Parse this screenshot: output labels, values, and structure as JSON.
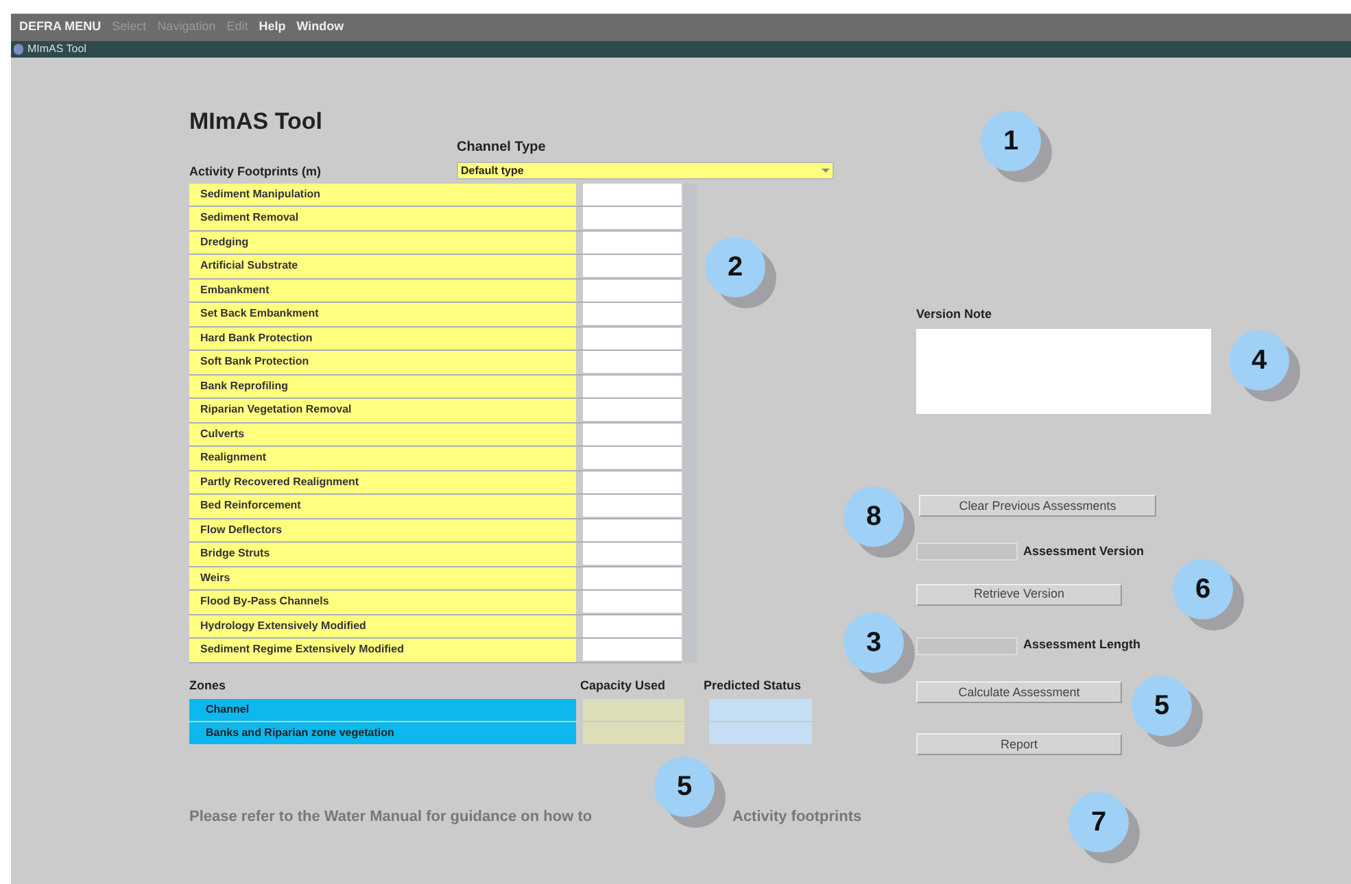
{
  "menu": [
    {
      "label": "DEFRA MENU",
      "disabled": false
    },
    {
      "label": "Select",
      "disabled": true
    },
    {
      "label": "Navigation",
      "disabled": true
    },
    {
      "label": "Edit",
      "disabled": true
    },
    {
      "label": "Help",
      "disabled": false
    },
    {
      "label": "Window",
      "disabled": false
    }
  ],
  "window": {
    "title": "MImAS Tool"
  },
  "form": {
    "title": "MImAS Tool",
    "channel_type": {
      "label": "Channel Type",
      "value": "Default type"
    },
    "activities_label": "Activity Footprints (m)",
    "activities": [
      "Sediment Manipulation",
      "Sediment Removal",
      "Dredging",
      "Artificial Substrate",
      "Embankment",
      "Set Back Embankment",
      "Hard Bank Protection",
      "Soft Bank Protection",
      "Bank Reprofiling",
      "Riparian Vegetation Removal",
      "Culverts",
      "Realignment",
      "Partly Recovered Realignment",
      "Bed Reinforcement",
      "Flow Deflectors",
      "Bridge Struts",
      "Weirs",
      "Flood By-Pass Channels",
      "Hydrology Extensively Modified",
      "Sediment Regime Extensively Modified"
    ],
    "zones_label": "Zones",
    "zone_columns": [
      "Capacity Used",
      "Predicted Status"
    ],
    "zones": [
      "Channel",
      "Banks and Riparian zone vegetation"
    ],
    "version_note": {
      "label": "Version Note"
    },
    "clear_button": "Clear Previous Assessments",
    "assessment_version": {
      "label": "Assessment Version"
    },
    "retrieve_button": "Retrieve Version",
    "assessment_length": {
      "label": "Assessment Length"
    },
    "calculate_button": "Calculate Assessment",
    "report_button": "Report",
    "footer_parts": [
      "Please refer to the Water Manual for guidance on how to",
      "Activity footprints"
    ]
  },
  "callouts": [
    "1",
    "2",
    "4",
    "8",
    "6",
    "3",
    "5",
    "5",
    "7"
  ]
}
